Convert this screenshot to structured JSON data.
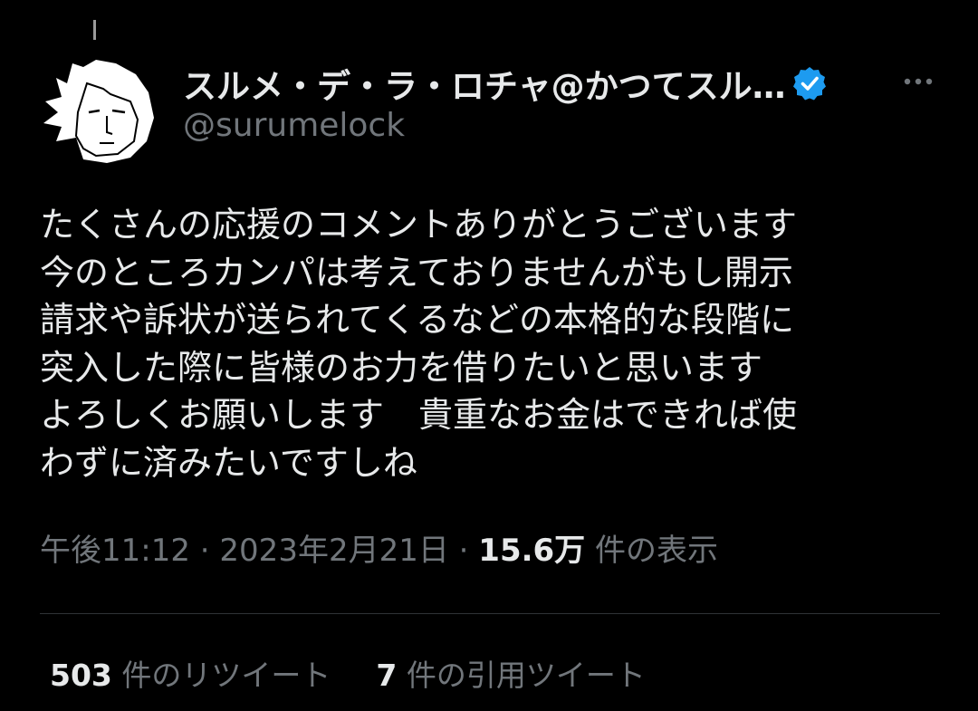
{
  "colors": {
    "background": "#000000",
    "primary_text": "#e7e9ea",
    "secondary_text": "#71767b",
    "divider": "#2f3336",
    "verified_badge": "#1d9bf0"
  },
  "author": {
    "display_name": "スルメ・デ・ラ・ロチャ@かつてスル…",
    "handle": "@surumelock",
    "verified_icon": "verified-badge-icon",
    "avatar_icon": "sketched-face-avatar"
  },
  "tweet": {
    "lines": [
      "たくさんの応援のコメントありがとうございます",
      "今のところカンパは考えておりませんがもし開示",
      "請求や訴状が送られてくるなどの本格的な段階に",
      "突入した際に皆様のお力を借りたいと思います",
      "よろしくお願いします　貴重なお金はできれば使",
      "わずに済みたいですしね"
    ]
  },
  "meta": {
    "time": "午後11:12",
    "separator1": " · ",
    "date": "2023年2月21日",
    "separator2": " · ",
    "views_count": "15.6万",
    "views_label": " 件の表示"
  },
  "stats": {
    "retweets_count": "503",
    "retweets_label": " 件のリツイート",
    "quotes_count": "7",
    "quotes_label": " 件の引用ツイート"
  },
  "more_icon": "more-horizontal-icon"
}
